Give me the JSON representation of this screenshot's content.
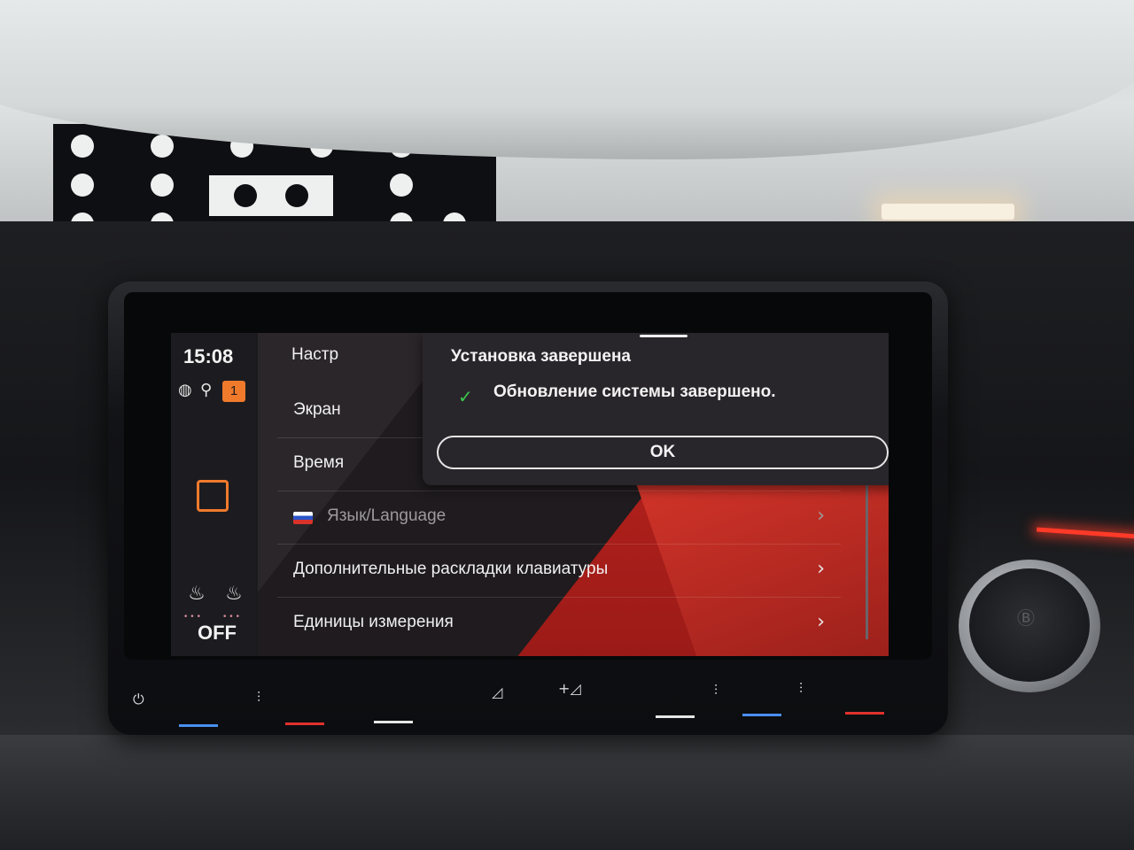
{
  "status_bar": {
    "time": "15:08",
    "notification_count": "1",
    "icons": [
      "globe-icon",
      "user-icon"
    ]
  },
  "sidebar": {
    "home_icon": "square-icon",
    "seat_heating_label": "OFF"
  },
  "settings": {
    "page_title_partial": "Настр",
    "rows": [
      {
        "label": "Экран",
        "chevron": "›"
      },
      {
        "label": "Время",
        "chevron": "›"
      },
      {
        "label": "Язык/Language",
        "chevron": "›",
        "flag": "ru-flag-icon"
      },
      {
        "label": "Дополнительные раскладки клавиатуры",
        "chevron": "›"
      },
      {
        "label": "Единицы измерения",
        "chevron": "›"
      }
    ]
  },
  "dialog": {
    "title": "Установка завершена",
    "message": "Обновление системы завершено.",
    "ok_label": "OK"
  },
  "colors": {
    "accent": "#f07a2c",
    "success": "#3bc84f",
    "background": "#2b262a",
    "red_stripe": "#c4261f"
  }
}
